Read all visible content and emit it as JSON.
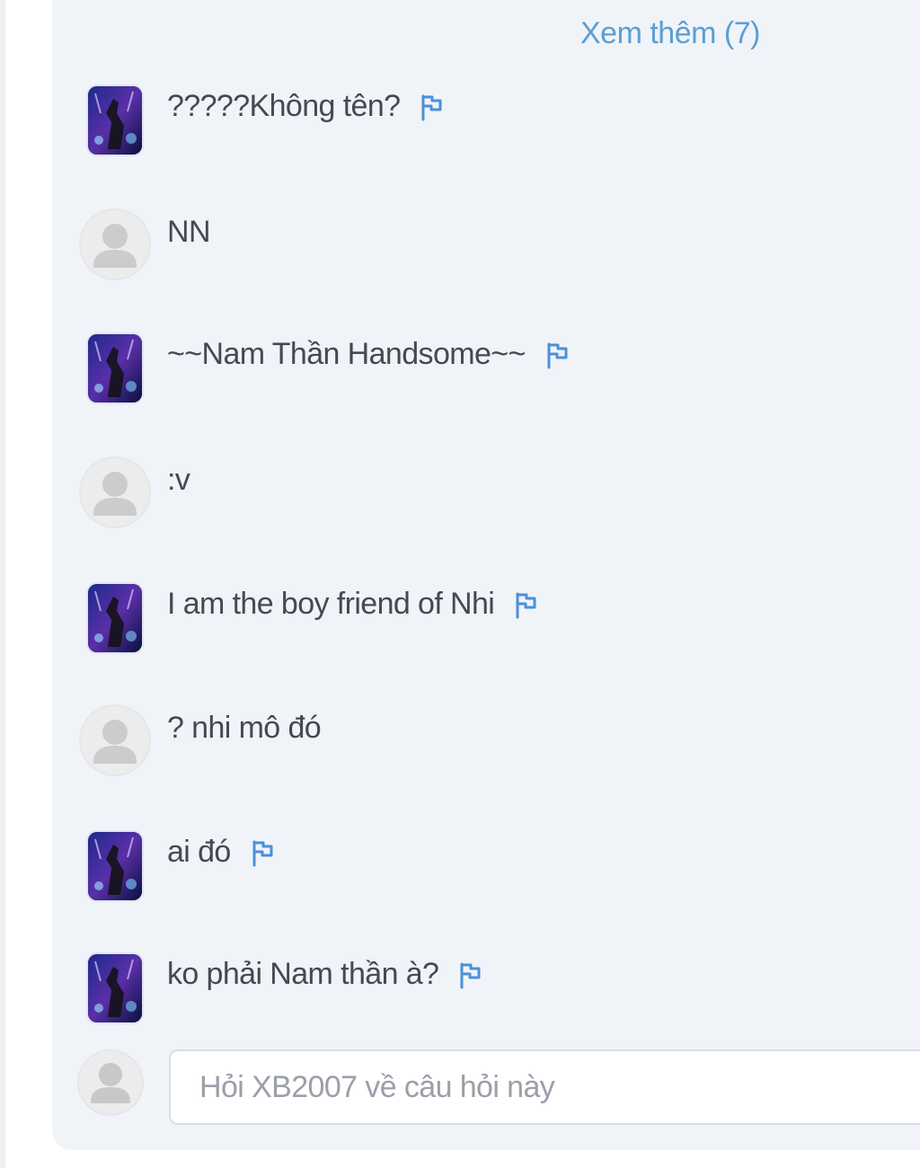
{
  "thread": {
    "see_more_label": "Xem thêm (7)",
    "comments": [
      {
        "author_type": "custom-avatar",
        "text": "?????Không tên?",
        "flag": true
      },
      {
        "author_type": "default-avatar",
        "text": "NN",
        "flag": false
      },
      {
        "author_type": "custom-avatar",
        "text": "~~Nam Thần Handsome~~",
        "flag": true
      },
      {
        "author_type": "default-avatar",
        "text": ":v",
        "flag": false
      },
      {
        "author_type": "custom-avatar",
        "text": "I am the boy friend of Nhi",
        "flag": true
      },
      {
        "author_type": "default-avatar",
        "text": "? nhi mô đó",
        "flag": false
      },
      {
        "author_type": "custom-avatar",
        "text": "ai đó",
        "flag": true
      },
      {
        "author_type": "custom-avatar",
        "text": "ko phải Nam thần à?",
        "flag": true
      }
    ]
  },
  "reply": {
    "placeholder": "Hỏi XB2007 về câu hỏi này"
  },
  "colors": {
    "panel_bg": "#f0f3f8",
    "accent": "#5a9fd4",
    "text": "#444a52",
    "placeholder": "#9aa0a8"
  },
  "icons": {
    "flag": "flag-icon",
    "default_user": "user-icon"
  }
}
